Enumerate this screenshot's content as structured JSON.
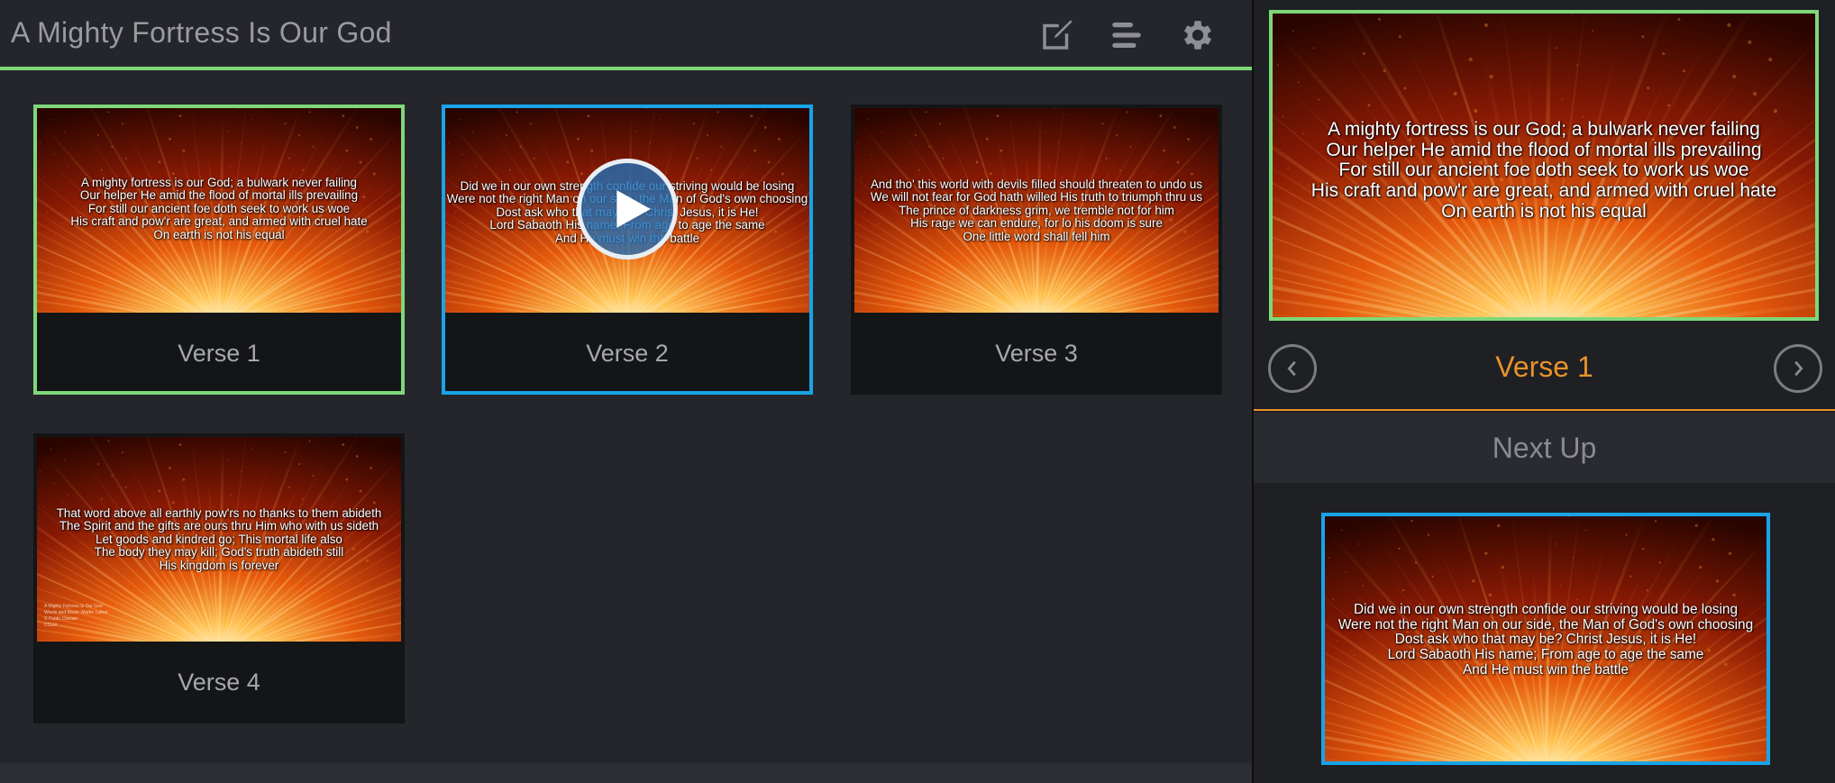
{
  "header": {
    "title": "A Mighty Fortress Is Our God",
    "icons": {
      "edit": "edit-icon",
      "list": "list-icon",
      "settings": "gear-icon"
    }
  },
  "slides": [
    {
      "label": "Verse 1",
      "state": "active",
      "lines": [
        "A mighty fortress is our God; a bulwark never failing",
        "Our helper He amid the flood of mortal ills prevailing",
        "For still our ancient foe doth seek to work us woe",
        "His craft and pow'r are great, and armed with cruel hate",
        "On earth is not his equal"
      ]
    },
    {
      "label": "Verse 2",
      "state": "next",
      "lines": [
        "Did we in our own strength confide our striving would be losing",
        "Were not the right Man on our side, the Man of God's own choosing",
        "Dost ask who that may be? Christ Jesus, it is He!",
        "Lord Sabaoth His name; From age to age the same",
        "And He must win the battle"
      ]
    },
    {
      "label": "Verse 3",
      "state": "plain",
      "lines": [
        "And tho' this world with devils filled should threaten to undo us",
        "We will not fear for God hath willed His truth to triumph thru us",
        "The prince of darkness grim, we tremble not for him",
        "His rage we can endure, for lo his doom is sure",
        "One little word shall fell him"
      ]
    },
    {
      "label": "Verse 4",
      "state": "plain",
      "lines": [
        "That word above all earthly pow'rs no thanks to them abideth",
        "The Spirit and the gifts are ours thru Him who with us sideth",
        "Let goods and kindred go; This mortal life also",
        "The body they may kill; God's truth abideth still",
        "His kingdom is forever"
      ],
      "credit": [
        "A Mighty Fortress Is Our God",
        "Words and Music: Martin Luther",
        "© Public Domain",
        "CCLI#"
      ]
    }
  ],
  "preview": {
    "current_label": "Verse 1",
    "next_up_label": "Next Up"
  },
  "colors": {
    "active": "#7ed87a",
    "next": "#18a4e8",
    "accent": "#e8932a"
  }
}
